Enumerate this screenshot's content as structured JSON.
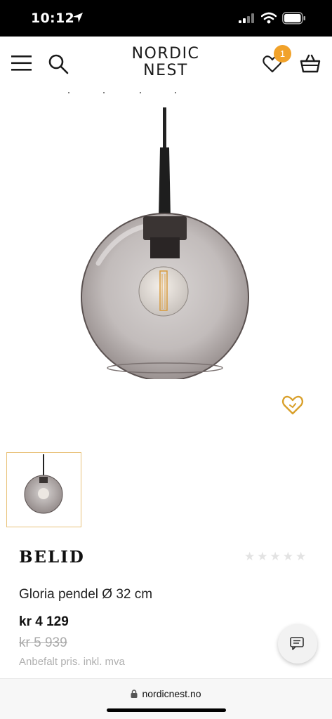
{
  "status_bar": {
    "time": "10:12"
  },
  "header": {
    "logo_line1": "NORDIC",
    "logo_line2": "NEST",
    "wishlist_count": "1"
  },
  "product": {
    "brand": "BELID",
    "name": "Gloria pendel Ø 32 cm",
    "price": "kr 4 129",
    "old_price": "kr 5 939",
    "price_note": "Anbefalt pris. inkl. mva",
    "rating": {
      "filled": 0,
      "max": 5
    }
  },
  "browser": {
    "url": "nordicnest.no"
  },
  "colors": {
    "accent": "#f1a22a",
    "favorite": "#d9a02b",
    "thumb_border": "#e9c27a"
  }
}
